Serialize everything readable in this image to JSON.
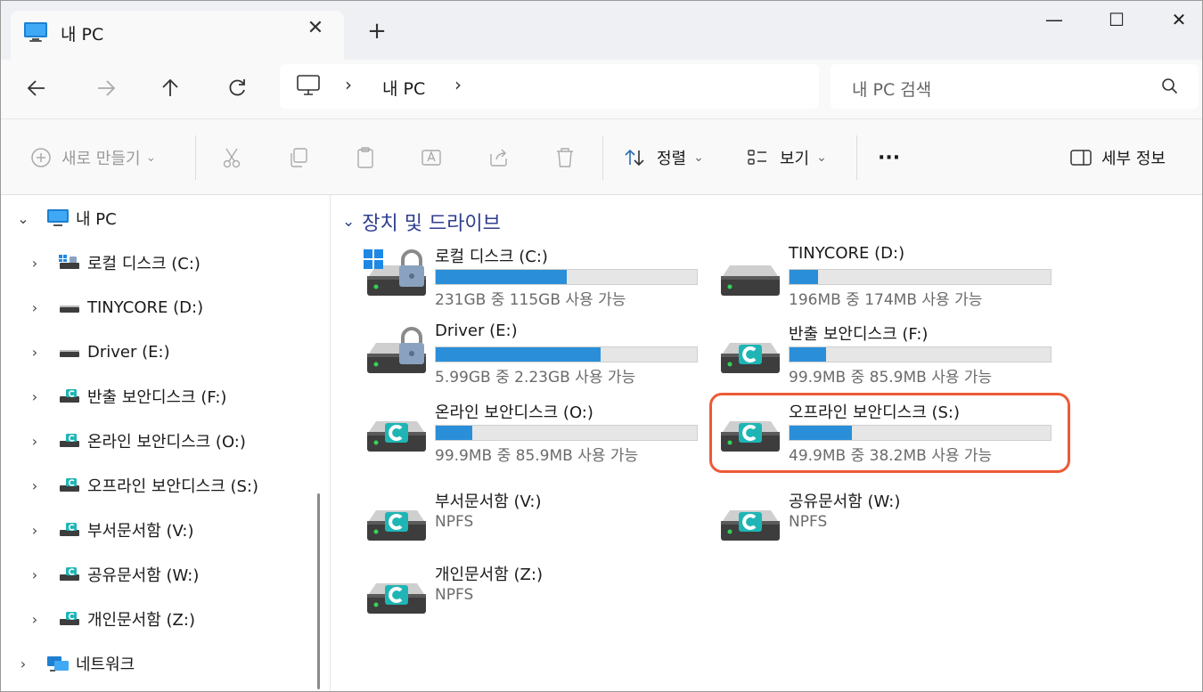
{
  "titlebar": {
    "tab_title": "내 PC",
    "close_glyph": "✕",
    "new_tab_glyph": "+",
    "minimize_glyph": "—",
    "maximize_glyph": "☐",
    "window_close_glyph": "✕"
  },
  "nav": {
    "address_text": "내 PC",
    "chevron": "›",
    "search_placeholder": "내 PC 검색"
  },
  "commands": {
    "new_label": "새로 만들기",
    "sort_label": "정렬",
    "view_label": "보기",
    "more_label": "···",
    "details_label": "세부 정보",
    "dropdown_glyph": "⌄"
  },
  "sidebar": {
    "items": [
      {
        "label": "내 PC",
        "icon": "monitor-icon"
      },
      {
        "label": "로컬 디스크 (C:)",
        "icon": "windows-drive-icon"
      },
      {
        "label": "TINYCORE (D:)",
        "icon": "drive-icon"
      },
      {
        "label": "Driver (E:)",
        "icon": "drive-icon"
      },
      {
        "label": "반출 보안디스크 (F:)",
        "icon": "secure-drive-icon"
      },
      {
        "label": "온라인 보안디스크 (O:)",
        "icon": "secure-drive-icon"
      },
      {
        "label": "오프라인 보안디스크 (S:)",
        "icon": "secure-drive-icon"
      },
      {
        "label": "부서문서함 (V:)",
        "icon": "secure-drive-icon"
      },
      {
        "label": "공유문서함 (W:)",
        "icon": "secure-drive-icon"
      },
      {
        "label": "개인문서함 (Z:)",
        "icon": "secure-drive-icon"
      },
      {
        "label": "네트워크",
        "icon": "network-icon"
      }
    ]
  },
  "main": {
    "group_title": "장치 및 드라이브",
    "group_chevron": "⌄",
    "drives": [
      {
        "name": "로컬 디스크 (C:)",
        "info": "231GB 중 115GB 사용 가능",
        "used_fraction": 0.5,
        "icon": "windows-drive-icon"
      },
      {
        "name": "TINYCORE (D:)",
        "info": "196MB 중 174MB 사용 가능",
        "used_fraction": 0.11,
        "icon": "drive-icon"
      },
      {
        "name": "Driver (E:)",
        "info": "5.99GB 중 2.23GB 사용 가능",
        "used_fraction": 0.63,
        "icon": "locked-drive-icon"
      },
      {
        "name": "반출 보안디스크 (F:)",
        "info": "99.9MB 중 85.9MB 사용 가능",
        "used_fraction": 0.14,
        "icon": "secure-drive-icon"
      },
      {
        "name": "온라인 보안디스크 (O:)",
        "info": "99.9MB 중 85.9MB 사용 가능",
        "used_fraction": 0.14,
        "icon": "secure-drive-icon"
      },
      {
        "name": "오프라인 보안디스크 (S:)",
        "info": "49.9MB 중 38.2MB 사용 가능",
        "used_fraction": 0.24,
        "icon": "secure-drive-icon"
      },
      {
        "name": "부서문서함 (V:)",
        "info": "NPFS",
        "icon": "secure-drive-icon"
      },
      {
        "name": "공유문서함 (W:)",
        "info": "NPFS",
        "icon": "secure-drive-icon"
      },
      {
        "name": "개인문서함 (Z:)",
        "info": "NPFS",
        "icon": "secure-drive-icon"
      }
    ]
  },
  "colors": {
    "accent": "#2a8fd8",
    "highlight": "#ee5a35",
    "group_title": "#2f3e8f"
  }
}
